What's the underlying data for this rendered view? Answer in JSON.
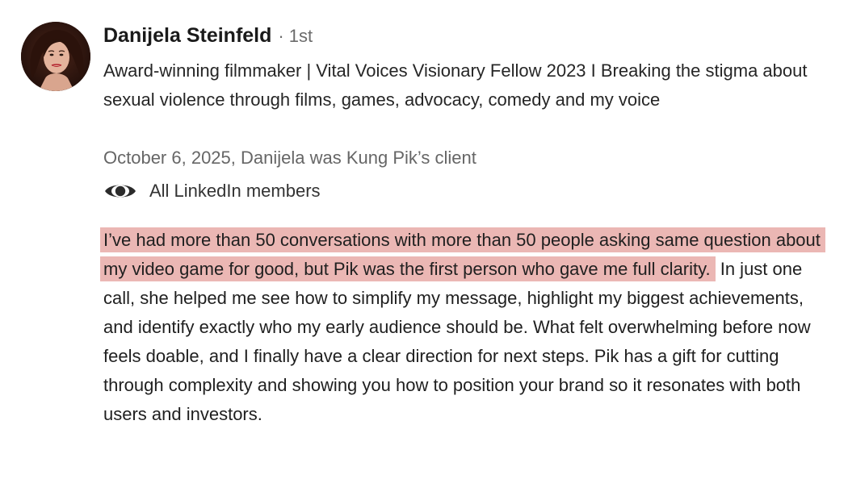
{
  "recommendation": {
    "author": {
      "name": "Danijela Steinfeld",
      "separator": "·",
      "connection_degree": "1st",
      "headline": "Award-winning filmmaker | Vital Voices Visionary Fellow 2023 I Breaking the stigma about sexual violence through films, games, advocacy, comedy and my voice"
    },
    "meta_line": "October 6, 2025, Danijela was Kung Pik’s client",
    "visibility": {
      "icon": "eye-icon",
      "label": "All LinkedIn members"
    },
    "body": {
      "highlighted": "I’ve had more than 50 conversations with more than 50 people asking same question about my video game for good, but Pik was the first person who gave me full clarity.",
      "rest": " In just one call, she helped me see how to simplify my message, highlight my biggest achievements, and identify exactly who my early audience should be. What felt overwhelming before now feels doable, and I finally have a clear direction for next steps. Pik has a gift for cutting through complexity and showing you how to position your brand so it resonates with both users and investors."
    },
    "colors": {
      "highlight": "#ebb7b4",
      "muted_text": "#666666"
    }
  }
}
